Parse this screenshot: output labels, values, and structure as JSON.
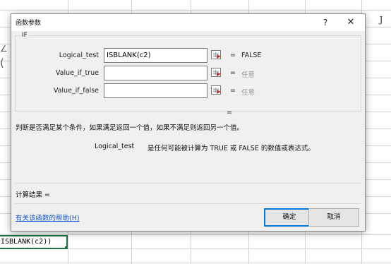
{
  "sheet": {
    "column_header_fragment": "J",
    "edge_fragment_a": "∠",
    "edge_fragment_b": "(",
    "formula_cell_text": "ISBLANK(c2))"
  },
  "dialog": {
    "title": "函数参数",
    "help_label": "?",
    "close_label": "✕",
    "function_name": "IF",
    "arguments": [
      {
        "label": "Logical_test",
        "value": "ISBLANK(c2)",
        "eq": "=",
        "result": "FALSE"
      },
      {
        "label": "Value_if_true",
        "value": "",
        "eq": "=",
        "result": "任意"
      },
      {
        "label": "Value_if_false",
        "value": "",
        "eq": "=",
        "result": "任意"
      }
    ],
    "result_eq": "=",
    "description": "判断是否满足某个条件，如果满足返回一个值，如果不满足则返回另一个值。",
    "arg_description_name": "Logical_test",
    "arg_description_text": "是任何可能被计算为 TRUE 或 FALSE 的数值或表达式。",
    "calc_result_label": "计算结果 =",
    "help_link": "有关该函数的帮助(H)",
    "ok_label": "确定",
    "cancel_label": "取消"
  },
  "colors": {
    "accent": "#0078d7",
    "link": "#1155cc",
    "cell_selection": "#217346",
    "dialog_bg": "#f0f0f0"
  }
}
